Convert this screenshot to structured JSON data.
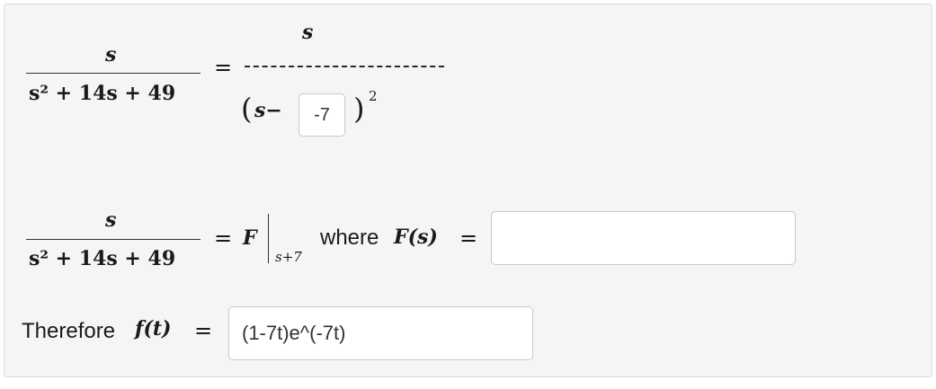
{
  "eq1": {
    "lhs_num": "s",
    "lhs_den": "s² + 14s + 49",
    "equals": "=",
    "rhs_num": "s",
    "open_paren": "(",
    "s_minus": "s−",
    "shift_value": "-7",
    "close_paren": ")",
    "exponent": "2"
  },
  "eq2": {
    "lhs_num": "s",
    "lhs_den": "s² + 14s + 49",
    "equals": "=",
    "F": "F",
    "eval_sub": "s+7",
    "where_text": "where",
    "F_of_s": "F(s)",
    "equals2": "=",
    "F_value": ""
  },
  "result": {
    "therefore_text": "Therefore",
    "f_of_t": "f(t)",
    "equals": "=",
    "f_value": "(1-7t)e^(-7t)"
  }
}
